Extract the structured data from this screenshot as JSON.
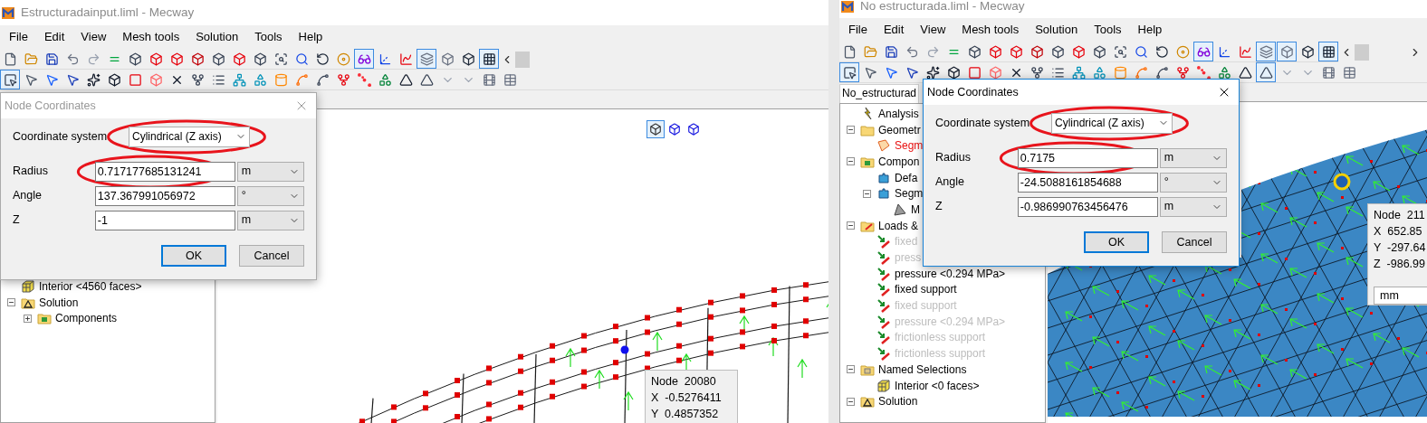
{
  "windows": [
    {
      "title": "Estructuradainput.liml - Mecway",
      "menu": [
        "File",
        "Edit",
        "View",
        "Mesh tools",
        "Solution",
        "Tools",
        "Help"
      ],
      "toolbar_rows": [
        [
          {
            "pressed": false
          },
          {
            "pressed": false
          },
          {
            "pressed": false
          },
          {
            "pressed": false
          },
          {
            "pressed": false
          },
          {
            "pressed": false
          },
          {
            "pressed": false
          },
          {
            "pressed": false
          },
          {
            "pressed": false
          },
          {
            "pressed": false
          },
          {
            "pressed": false
          },
          {
            "pressed": false
          },
          {
            "pressed": false
          },
          {
            "pressed": false
          },
          {
            "pressed": false
          },
          {
            "pressed": false
          },
          {
            "pressed": false
          },
          {
            "pressed": true
          },
          {
            "pressed": false
          },
          {
            "pressed": false
          },
          {
            "pressed": true
          },
          {
            "pressed": false
          },
          {
            "pressed": false
          },
          {
            "pressed": true
          }
        ],
        [
          {
            "pressed": true
          },
          {
            "pressed": false
          },
          {
            "pressed": false
          },
          {
            "pressed": false
          },
          {
            "pressed": false
          },
          {
            "pressed": false
          },
          {
            "pressed": false
          },
          {
            "pressed": false
          },
          {
            "pressed": false
          },
          {
            "pressed": false
          },
          {
            "pressed": false
          },
          {
            "pressed": false
          },
          {
            "pressed": false
          },
          {
            "pressed": false
          },
          {
            "pressed": false
          },
          {
            "pressed": false
          },
          {
            "pressed": false
          },
          {
            "pressed": false
          },
          {
            "pressed": false
          },
          {
            "pressed": false
          },
          {
            "pressed": false
          },
          {
            "pressed": false
          },
          {
            "pressed": false
          },
          {
            "pressed": false
          },
          {
            "pressed": false
          }
        ]
      ],
      "tree": [
        {
          "label": "Interior <4560 faces>",
          "kind": "selection",
          "selected": false,
          "disabled": false
        },
        {
          "label": "Solution",
          "kind": "solution",
          "expanded": true,
          "selected": false,
          "disabled": false,
          "children": [
            {
              "label": "Components",
              "kind": "components",
              "expanded": false,
              "selected": false,
              "disabled": false
            }
          ]
        }
      ],
      "view_buttons": [
        {
          "pressed": true
        },
        {
          "pressed": false
        },
        {
          "pressed": false
        }
      ],
      "node_tooltip": {
        "lines": [
          "Node  20080",
          "X  -0.5276411",
          "Y  0.4857352"
        ]
      },
      "dialog": {
        "title": "Node Coordinates",
        "active": false,
        "system_label": "Coordinate system",
        "system": {
          "value": "Cylindrical (Z axis)",
          "circled": true
        },
        "fields": [
          {
            "label": "Radius",
            "value": "0.717177685131241",
            "unit": "m",
            "circled": true
          },
          {
            "label": "Angle",
            "value": "137.367991056972",
            "unit": "°",
            "circled": false
          },
          {
            "label": "Z",
            "value": "-1",
            "unit": "m",
            "circled": false
          }
        ],
        "buttons": [
          {
            "label": "OK",
            "default": true
          },
          {
            "label": "Cancel",
            "default": false
          }
        ]
      }
    },
    {
      "title": "No estructurada.liml - Mecway",
      "menu": [
        "File",
        "Edit",
        "View",
        "Mesh tools",
        "Solution",
        "Tools",
        "Help"
      ],
      "toolbar_rows": [
        [
          {
            "pressed": false
          },
          {
            "pressed": false
          },
          {
            "pressed": false
          },
          {
            "pressed": false
          },
          {
            "pressed": false
          },
          {
            "pressed": false
          },
          {
            "pressed": false
          },
          {
            "pressed": false
          },
          {
            "pressed": false
          },
          {
            "pressed": false
          },
          {
            "pressed": false
          },
          {
            "pressed": false
          },
          {
            "pressed": false
          },
          {
            "pressed": false
          },
          {
            "pressed": false
          },
          {
            "pressed": false
          },
          {
            "pressed": false
          },
          {
            "pressed": true
          },
          {
            "pressed": false
          },
          {
            "pressed": false
          },
          {
            "pressed": true
          },
          {
            "pressed": true
          },
          {
            "pressed": false
          },
          {
            "pressed": true
          }
        ],
        [
          {
            "pressed": true
          },
          {
            "pressed": false
          },
          {
            "pressed": false
          },
          {
            "pressed": false
          },
          {
            "pressed": false
          },
          {
            "pressed": false
          },
          {
            "pressed": false
          },
          {
            "pressed": false
          },
          {
            "pressed": false
          },
          {
            "pressed": false
          },
          {
            "pressed": false
          },
          {
            "pressed": false
          },
          {
            "pressed": false
          },
          {
            "pressed": false
          },
          {
            "pressed": false
          },
          {
            "pressed": false
          },
          {
            "pressed": false
          },
          {
            "pressed": false
          },
          {
            "pressed": false
          },
          {
            "pressed": false
          },
          {
            "pressed": true
          },
          {
            "pressed": false
          },
          {
            "pressed": false
          },
          {
            "pressed": false
          },
          {
            "pressed": false
          }
        ]
      ],
      "tab": "No_estructurad",
      "tree": [
        {
          "label": "Analysis",
          "kind": "analysis",
          "selected": false,
          "disabled": false
        },
        {
          "label": "Geometr",
          "kind": "folder",
          "expanded": true,
          "selected": false,
          "disabled": false,
          "children": [
            {
              "label": "Segm",
              "kind": "part",
              "selected": true,
              "disabled": false
            }
          ]
        },
        {
          "label": "Compon",
          "kind": "components",
          "expanded": true,
          "selected": false,
          "disabled": false,
          "children": [
            {
              "label": "Defa",
              "kind": "component",
              "selected": false,
              "disabled": false
            },
            {
              "label": "Segm",
              "kind": "component",
              "expanded": true,
              "selected": false,
              "disabled": false,
              "children": [
                {
                  "label": "M",
                  "kind": "mesh",
                  "selected": false,
                  "disabled": false
                }
              ]
            }
          ]
        },
        {
          "label": "Loads &",
          "kind": "loads",
          "expanded": true,
          "selected": false,
          "disabled": false,
          "children": [
            {
              "label": "fixed",
              "kind": "load",
              "selected": false,
              "disabled": true
            },
            {
              "label": "press",
              "kind": "load",
              "selected": false,
              "disabled": true
            },
            {
              "label": "pressure <0.294 MPa>",
              "kind": "load",
              "selected": false,
              "disabled": false
            },
            {
              "label": "fixed support",
              "kind": "load",
              "selected": false,
              "disabled": false
            },
            {
              "label": "fixed support",
              "kind": "load",
              "selected": false,
              "disabled": true
            },
            {
              "label": "pressure <0.294 MPa>",
              "kind": "load",
              "selected": false,
              "disabled": true
            },
            {
              "label": "frictionless support",
              "kind": "load",
              "selected": false,
              "disabled": true
            },
            {
              "label": "frictionless support",
              "kind": "load",
              "selected": false,
              "disabled": true
            }
          ]
        },
        {
          "label": "Named Selections",
          "kind": "named",
          "expanded": true,
          "selected": false,
          "disabled": false,
          "children": [
            {
              "label": "Interior <0 faces>",
              "kind": "selection",
              "selected": false,
              "disabled": false
            }
          ]
        },
        {
          "label": "Solution",
          "kind": "solution",
          "expanded": true,
          "selected": false,
          "disabled": false
        }
      ],
      "node_tooltip": {
        "lines": [
          "Node  211",
          "X  652.85",
          "Y  -297.64",
          "Z  -986.99"
        ],
        "unit": "mm"
      },
      "dialog": {
        "title": "Node Coordinates",
        "active": true,
        "system_label": "Coordinate system",
        "system": {
          "value": "Cylindrical (Z axis)",
          "circled": true
        },
        "fields": [
          {
            "label": "Radius",
            "value": "0.7175",
            "unit": "m",
            "circled": true
          },
          {
            "label": "Angle",
            "value": "-24.5088161854688",
            "unit": "°",
            "circled": false
          },
          {
            "label": "Z",
            "value": "-0.986990763456476",
            "unit": "m",
            "circled": false
          }
        ],
        "buttons": [
          {
            "label": "OK",
            "default": true
          },
          {
            "label": "Cancel",
            "default": false
          }
        ]
      }
    }
  ]
}
